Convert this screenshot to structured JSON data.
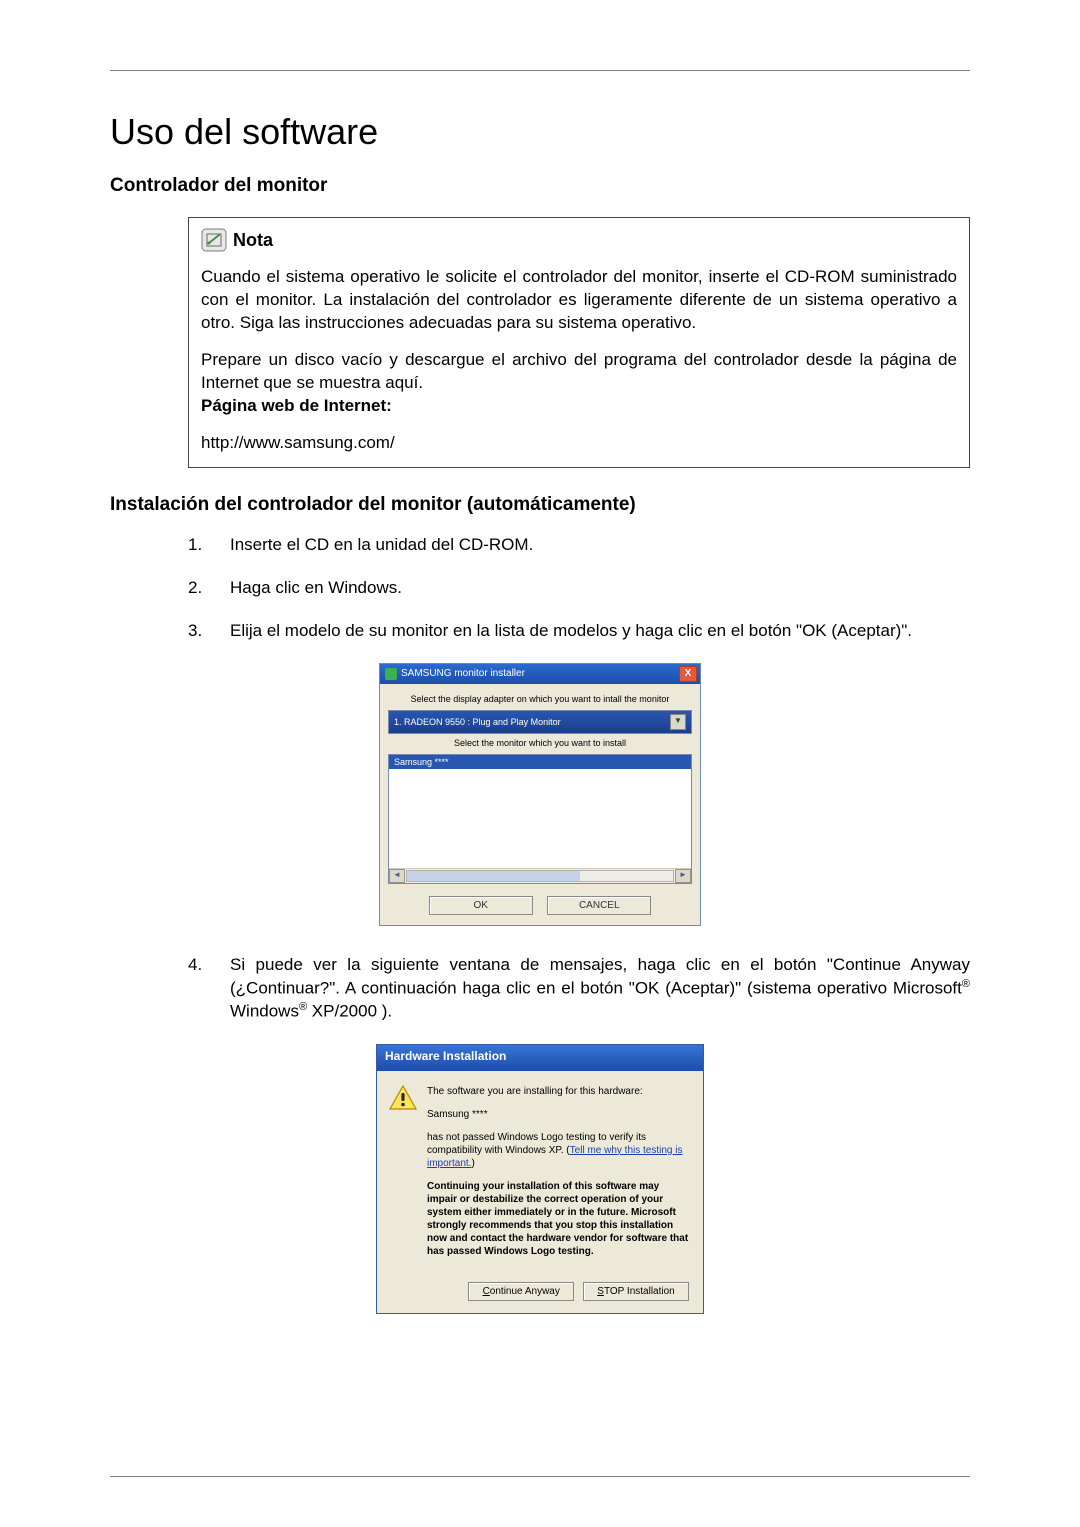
{
  "title": "Uso del software",
  "section1_heading": "Controlador del monitor",
  "nota": {
    "label": "Nota",
    "p1": "Cuando el sistema operativo le solicite el controlador del monitor, inserte el CD-ROM suministrado con el monitor. La instalación del controlador es ligeramente diferente de un sistema operativo a otro. Siga las instrucciones adecuadas para su sistema operativo.",
    "p2": "Prepare un disco vacío y descargue el archivo del programa del controlador desde la página de Internet que se muestra aquí.",
    "web_label": "Página web de Internet:",
    "url": "http://www.samsung.com/"
  },
  "section2_heading": "Instalación del controlador del monitor (automáticamente)",
  "steps": {
    "s1_num": "1.",
    "s1": "Inserte el CD en la unidad del CD-ROM.",
    "s2_num": "2.",
    "s2": "Haga clic en Windows.",
    "s3_num": "3.",
    "s3": "Elija el modelo de su monitor en la lista de modelos y haga clic en el botón \"OK (Aceptar)\".",
    "s4_num": "4.",
    "s4_a": "Si puede ver la siguiente ventana de mensajes, haga clic en el botón \"Continue Anyway (¿Continuar?\". A continuación haga clic en el botón \"OK (Aceptar)\" (sistema operativo Microsoft",
    "s4_b": " Windows",
    "s4_c": " XP/2000 ).",
    "reg": "®"
  },
  "installer": {
    "title": "SAMSUNG monitor installer",
    "text1": "Select the display adapter on which you want to intall the monitor",
    "adapter": "1. RADEON 9550 : Plug and Play Monitor",
    "text2": "Select the monitor which you want to install",
    "selected": "Samsung ****",
    "ok": "OK",
    "cancel": "CANCEL",
    "close_x": "X",
    "arrow_down": "▼",
    "arrow_left": "◄",
    "arrow_right": "►"
  },
  "hw": {
    "title": "Hardware Installation",
    "line1": "The software you are installing for this hardware:",
    "device": "Samsung ****",
    "line2a": "has not passed Windows Logo testing to verify its compatibility with Windows XP. (",
    "link": "Tell me why this testing is important.",
    "line2b": ")",
    "warn": "Continuing your installation of this software may impair or destabilize the correct operation of your system either immediately or in the future. Microsoft strongly recommends that you stop this installation now and contact the hardware vendor for software that has passed Windows Logo testing.",
    "continue_u": "C",
    "continue_rest": "ontinue Anyway",
    "stop_u": "S",
    "stop_rest": "TOP Installation"
  }
}
